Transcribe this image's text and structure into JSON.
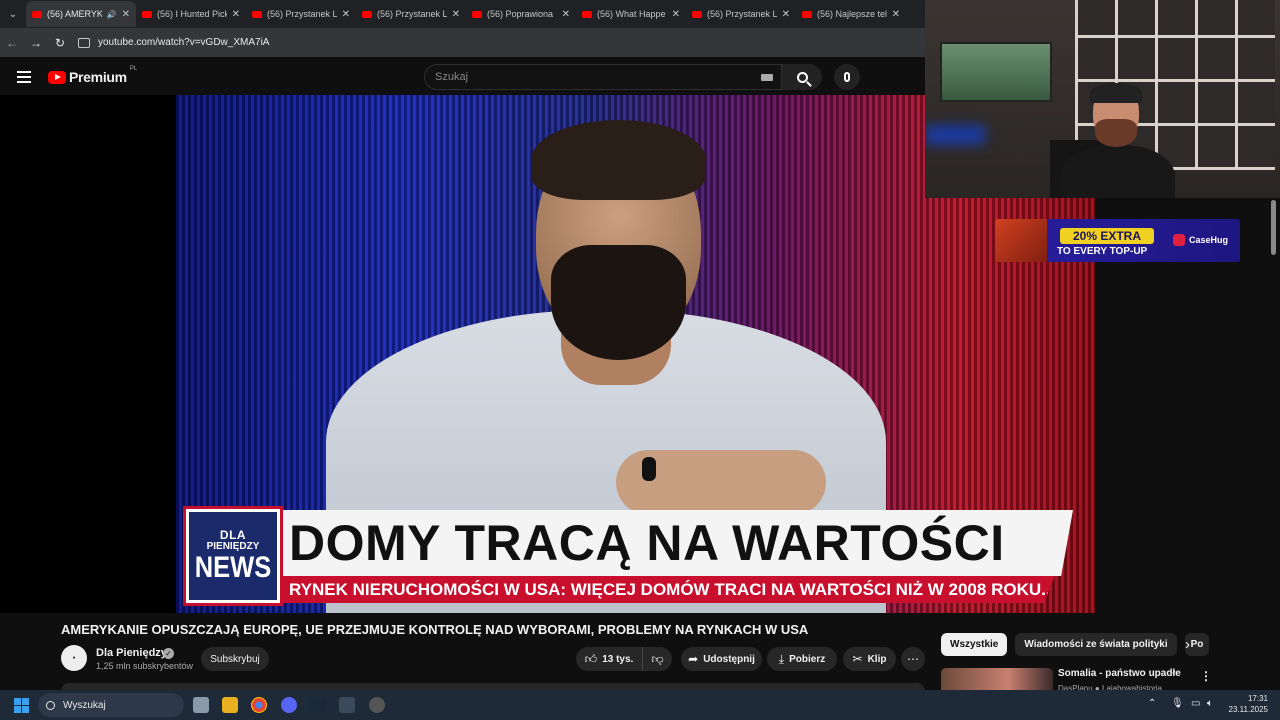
{
  "browser": {
    "tabs": [
      {
        "label": "(56) AMERYKA",
        "active": true,
        "audio": true
      },
      {
        "label": "(56) I Hunted Pick"
      },
      {
        "label": "(56) Przystanek L"
      },
      {
        "label": "(56) Przystanek L"
      },
      {
        "label": "(56) Poprawiona"
      },
      {
        "label": "(56) What Happe"
      },
      {
        "label": "(56) Przystanek L"
      },
      {
        "label": "(56) Najlepsze tel"
      }
    ],
    "url": "youtube.com/watch?v=vGDw_XMA7iA"
  },
  "header": {
    "brand": "Premium",
    "region": "PL",
    "search_placeholder": "Szukaj"
  },
  "video": {
    "badge_line1": "DLA",
    "badge_line2": "PIENIĘDZY",
    "badge_line3": "NEWS",
    "headline": "DOMY TRACĄ NA WARTOŚCI",
    "subheadline": "RYNEK NIERUCHOMOŚCI W USA: WIĘCEJ DOMÓW TRACI NA WARTOŚCI NIŻ W 2008 ROKU..."
  },
  "meta": {
    "title": "AMERYKANIE OPUSZCZAJĄ EUROPĘ, UE PRZEJMUJE KONTROLĘ NAD WYBORAMI, PROBLEMY NA RYNKACH W USA",
    "channel": "Dla Pieniędzy",
    "subscribers": "1,25 mln subskrybentów",
    "subscribe": "Subskrybuj",
    "likes": "13 tys.",
    "share": "Udostępnij",
    "download": "Pobierz",
    "clip": "Klip"
  },
  "ad": {
    "extra": "20% EXTRA",
    "cta": "TO EVERY TOP-UP",
    "brand": "CaseHug"
  },
  "chips": [
    "Wszystkie",
    "Wiadomości ze świata polityki",
    "Po"
  ],
  "recommendation": {
    "title": "Somalia - państwo upadłe",
    "meta": "DasPlanu ● Lajahowahistoria"
  },
  "taskbar": {
    "search": "Wyszukaj",
    "time": "17:31",
    "date": "23.11.2025"
  },
  "colors": {
    "youtube_red": "#ff0000",
    "news_red": "#c8102e",
    "ad_yellow": "#f0d020"
  }
}
